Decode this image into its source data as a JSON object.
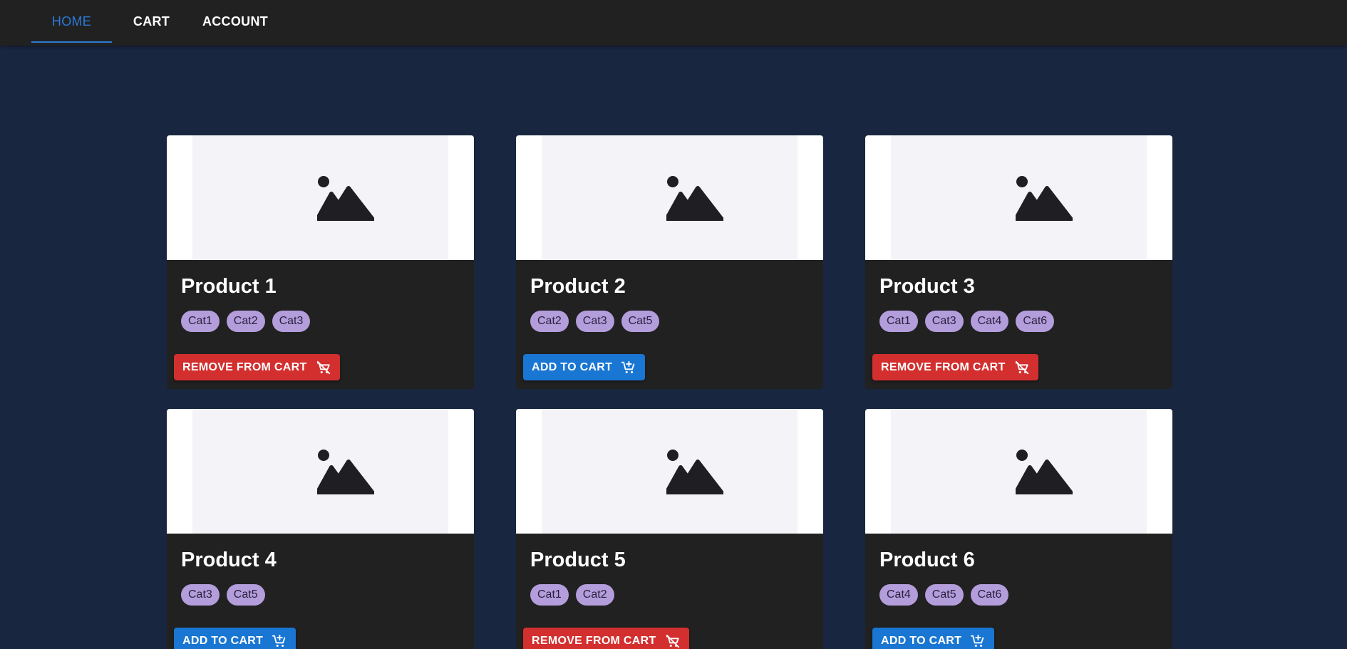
{
  "nav": {
    "tabs": [
      {
        "label": "HOME",
        "active": true
      },
      {
        "label": "CART",
        "active": false
      },
      {
        "label": "ACCOUNT",
        "active": false
      }
    ]
  },
  "colors": {
    "page_background": "#19263f",
    "toolbar": "#212121",
    "card": "#212121",
    "accent_blue": "#1976d2",
    "danger_red": "#d32f2f",
    "chip": "#b39ddb"
  },
  "products": [
    {
      "title": "Product 1",
      "categories": [
        "Cat1",
        "Cat2",
        "Cat3"
      ],
      "in_cart": true,
      "button_label": "REMOVE FROM CART",
      "image_icon": "image-placeholder-icon"
    },
    {
      "title": "Product 2",
      "categories": [
        "Cat2",
        "Cat3",
        "Cat5"
      ],
      "in_cart": false,
      "button_label": "ADD TO CART",
      "image_icon": "image-placeholder-icon"
    },
    {
      "title": "Product 3",
      "categories": [
        "Cat1",
        "Cat3",
        "Cat4",
        "Cat6"
      ],
      "in_cart": true,
      "button_label": "REMOVE FROM CART",
      "image_icon": "image-placeholder-icon"
    },
    {
      "title": "Product 4",
      "categories": [
        "Cat3",
        "Cat5"
      ],
      "in_cart": false,
      "button_label": "ADD TO CART",
      "image_icon": "image-placeholder-icon"
    },
    {
      "title": "Product 5",
      "categories": [
        "Cat1",
        "Cat2"
      ],
      "in_cart": true,
      "button_label": "REMOVE FROM CART",
      "image_icon": "image-placeholder-icon"
    },
    {
      "title": "Product 6",
      "categories": [
        "Cat4",
        "Cat5",
        "Cat6"
      ],
      "in_cart": false,
      "button_label": "ADD TO CART",
      "image_icon": "image-placeholder-icon"
    }
  ]
}
